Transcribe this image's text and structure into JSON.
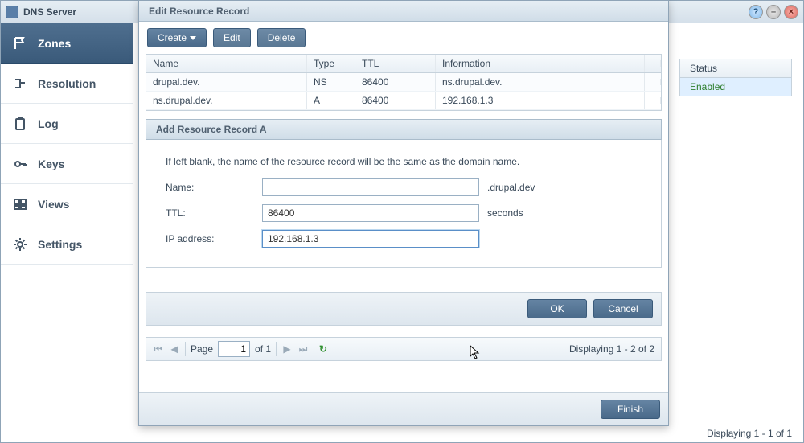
{
  "app": {
    "title": "DNS Server"
  },
  "sidebar": {
    "items": [
      {
        "label": "Zones",
        "icon": "flag-icon",
        "active": true
      },
      {
        "label": "Resolution",
        "icon": "resolution-icon"
      },
      {
        "label": "Log",
        "icon": "clipboard-icon"
      },
      {
        "label": "Keys",
        "icon": "key-icon"
      },
      {
        "label": "Views",
        "icon": "views-icon"
      },
      {
        "label": "Settings",
        "icon": "gear-icon"
      }
    ]
  },
  "main_list": {
    "status_header": "Status",
    "status_value": "Enabled",
    "footer": "Displaying 1 - 1 of 1"
  },
  "modal": {
    "title": "Edit Resource Record",
    "toolbar": {
      "create": "Create",
      "edit": "Edit",
      "delete": "Delete"
    },
    "grid": {
      "headers": {
        "name": "Name",
        "type": "Type",
        "ttl": "TTL",
        "info": "Information"
      },
      "rows": [
        {
          "name": "drupal.dev.",
          "type": "NS",
          "ttl": "86400",
          "info": "ns.drupal.dev."
        },
        {
          "name": "ns.drupal.dev.",
          "type": "A",
          "ttl": "86400",
          "info": "192.168.1.3"
        }
      ]
    },
    "inner": {
      "title": "Add Resource Record A",
      "hint": "If left blank, the name of the resource record will be the same as the domain name.",
      "fields": {
        "name": {
          "label": "Name:",
          "value": "",
          "suffix": ".drupal.dev"
        },
        "ttl": {
          "label": "TTL:",
          "value": "86400",
          "suffix": "seconds"
        },
        "ip": {
          "label": "IP address:",
          "value": "192.168.1.3"
        }
      },
      "buttons": {
        "ok": "OK",
        "cancel": "Cancel"
      }
    },
    "pager": {
      "page_label": "Page",
      "page": "1",
      "of_label": "of 1",
      "status": "Displaying 1 - 2 of 2"
    },
    "footer": {
      "finish": "Finish"
    }
  }
}
